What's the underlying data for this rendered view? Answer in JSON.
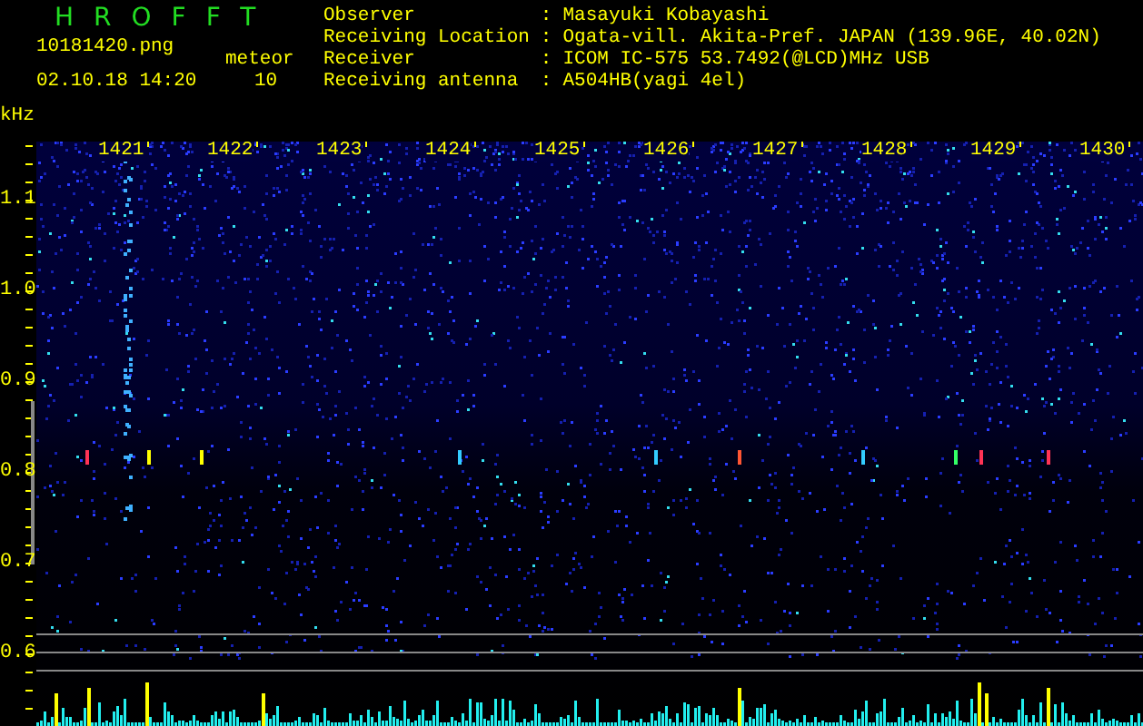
{
  "app_title": "HROFFT",
  "file_name": "10181420.png",
  "timestamp": "02.10.18 14:20",
  "meteor_label": "meteor",
  "meteor_count": "10",
  "info": [
    {
      "label": "Observer",
      "value": "Masayuki Kobayashi"
    },
    {
      "label": "Receiving Location",
      "value": "Ogata-vill. Akita-Pref. JAPAN (139.96E, 40.02N)"
    },
    {
      "label": "Receiver",
      "value": "ICOM IC-575 53.7492(@LCD)MHz USB"
    },
    {
      "label": "Receiving antenna",
      "value": "A504HB(yagi 4el)"
    }
  ],
  "separator": ":",
  "y_unit": "kHz",
  "y_labels": [
    "1.1",
    "1.0",
    "0.9",
    "0.8",
    "0.7",
    "0.6"
  ],
  "time_labels": [
    "1421",
    "1422",
    "1423",
    "1424",
    "1425",
    "1426",
    "1427",
    "1428",
    "1429",
    "1430"
  ]
}
